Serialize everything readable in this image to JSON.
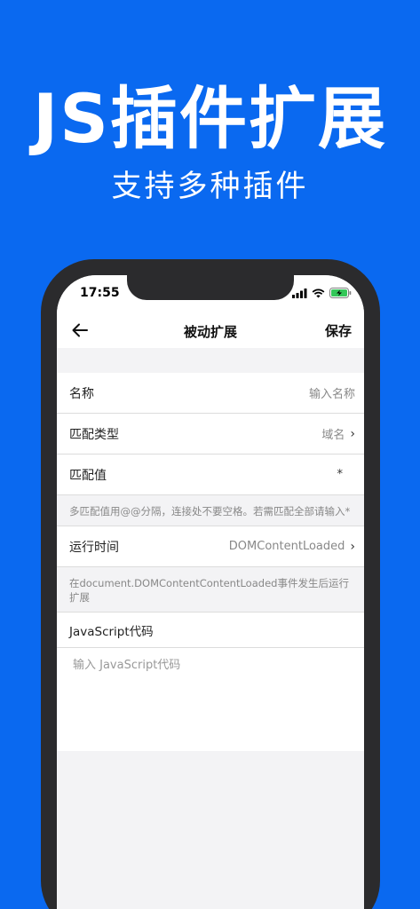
{
  "promo": {
    "title": "JS插件扩展",
    "subtitle": "支持多种插件"
  },
  "status_bar": {
    "time": "17:55"
  },
  "nav": {
    "title": "被动扩展",
    "save_label": "保存"
  },
  "form": {
    "name": {
      "label": "名称",
      "placeholder": "输入名称"
    },
    "match_type": {
      "label": "匹配类型",
      "value": "域名"
    },
    "match_value": {
      "label": "匹配值",
      "value": "*"
    },
    "match_hint": "多匹配值用@@分隔，连接处不要空格。若需匹配全部请输入*",
    "run_time": {
      "label": "运行时间",
      "value": "DOMContentLoaded"
    },
    "run_time_hint": "在document.DOMContentContentLoaded事件发生后运行扩展",
    "code": {
      "label": "JavaScript代码",
      "placeholder": "输入 JavaScript代码"
    }
  },
  "colors": {
    "background": "#0A69F0",
    "battery": "#34C759"
  }
}
